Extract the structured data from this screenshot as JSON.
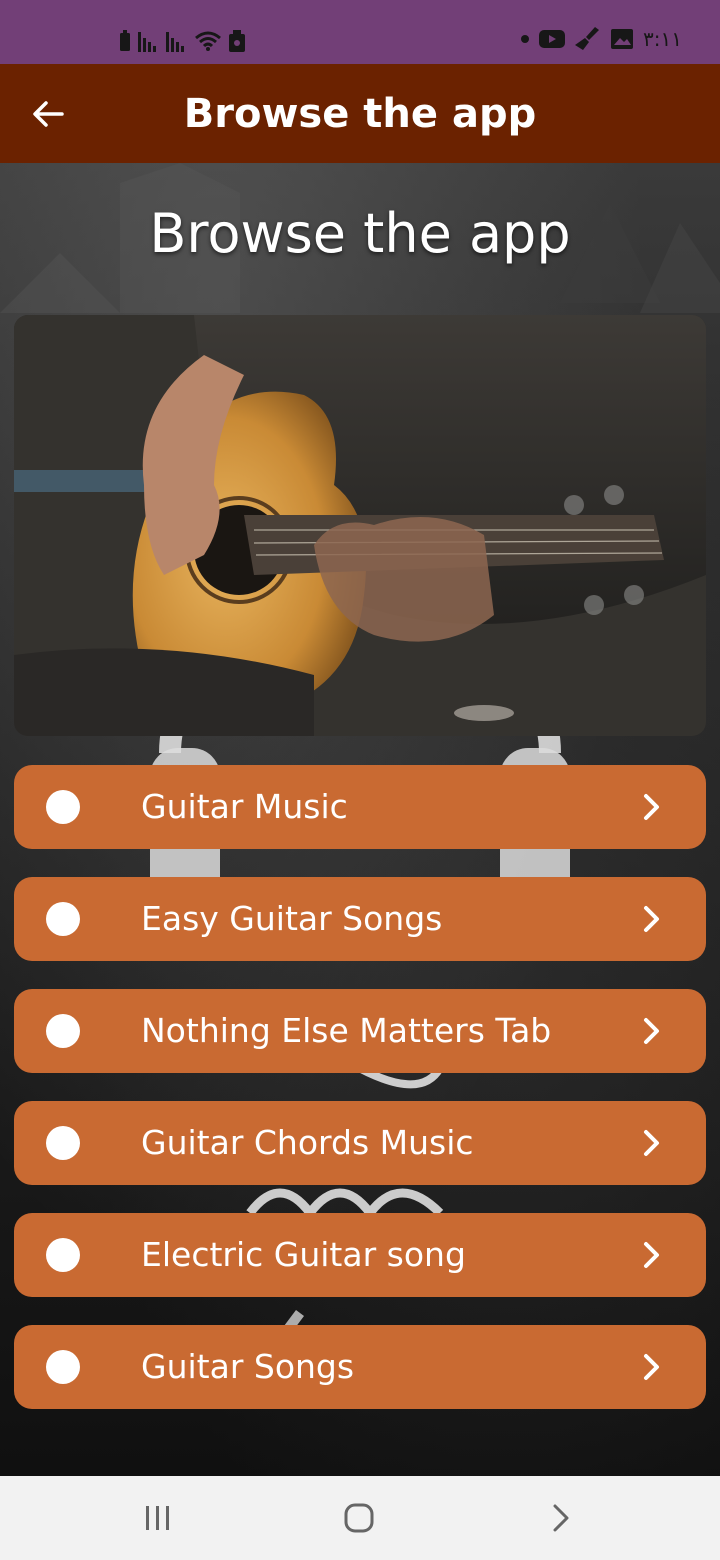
{
  "status_bar": {
    "time": "٣:١١",
    "icons": [
      "battery-icon",
      "signal-icon",
      "signal-icon",
      "wifi-icon",
      "notification-icon",
      "dot-icon",
      "youtube-icon",
      "cleaner-icon",
      "image-icon"
    ]
  },
  "app_bar": {
    "title": "Browse the app",
    "back_icon": "arrow-left-icon"
  },
  "main": {
    "heading": "Browse the app",
    "hero_image": "guitar-player-image",
    "menu_items": [
      {
        "label": "Guitar Music"
      },
      {
        "label": "Easy Guitar Songs"
      },
      {
        "label": "Nothing Else Matters Tab"
      },
      {
        "label": "Guitar Chords Music"
      },
      {
        "label": "Electric Guitar song"
      },
      {
        "label": "Guitar Songs"
      }
    ]
  },
  "nav_bar": {
    "buttons": [
      "recents-icon",
      "home-icon",
      "back-icon"
    ]
  },
  "colors": {
    "status_bar": "#723f77",
    "app_bar": "#6b2200",
    "menu_item": "#c96a32",
    "nav_bar": "#f2f2f2"
  }
}
